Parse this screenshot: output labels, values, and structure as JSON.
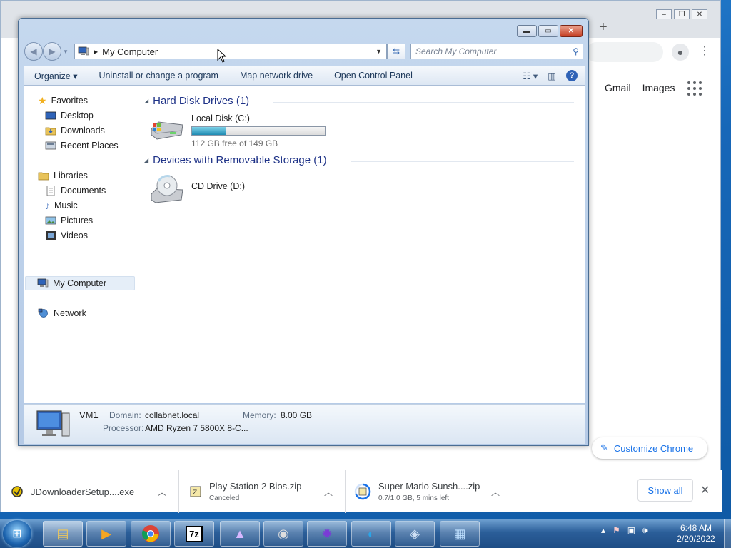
{
  "chrome": {
    "links": [
      "Gmail",
      "Images"
    ],
    "customize_label": "Customize Chrome"
  },
  "downloads": {
    "items": [
      {
        "name": "JDownloaderSetup....exe",
        "status": ""
      },
      {
        "name": "Play Station 2 Bios.zip",
        "status": "Canceled"
      },
      {
        "name": "Super Mario Sunsh....zip",
        "status": "0.7/1.0 GB, 5 mins left",
        "progress": 0.7
      }
    ],
    "show_all_label": "Show all"
  },
  "explorer": {
    "address": "My Computer",
    "search_placeholder": "Search My Computer",
    "commands": [
      "Organize",
      "Uninstall or change a program",
      "Map network drive",
      "Open Control Panel"
    ],
    "nav": {
      "favorites": "Favorites",
      "desktop": "Desktop",
      "downloads": "Downloads",
      "recent": "Recent Places",
      "libraries": "Libraries",
      "documents": "Documents",
      "music": "Music",
      "pictures": "Pictures",
      "videos": "Videos",
      "mycomputer": "My Computer",
      "network": "Network"
    },
    "groups": {
      "hdd": "Hard Disk Drives (1)",
      "removable": "Devices with Removable Storage (1)"
    },
    "drives": {
      "c_name": "Local Disk (C:)",
      "c_free": "112 GB free of 149 GB",
      "c_used_fraction": 0.25,
      "d_name": "CD Drive (D:)"
    },
    "details": {
      "computer_name": "VM1",
      "domain_label": "Domain:",
      "domain": "collabnet.local",
      "memory_label": "Memory:",
      "memory": "8.00 GB",
      "processor_label": "Processor:",
      "processor": "AMD Ryzen 7 5800X 8-C..."
    }
  },
  "taskbar": {
    "time": "6:48 AM",
    "date": "2/20/2022"
  }
}
